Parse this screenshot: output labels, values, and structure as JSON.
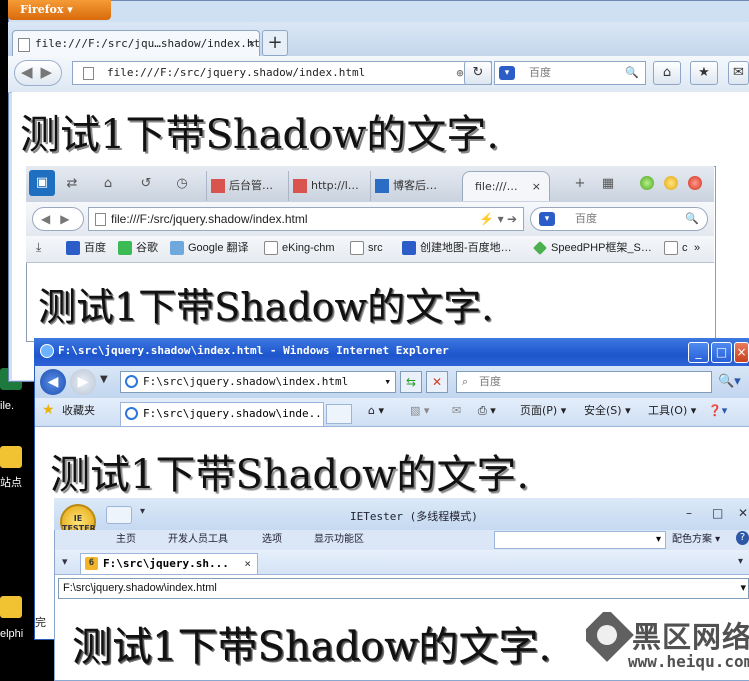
{
  "desktop": {
    "labels": [
      "ile.",
      "站点",
      "elphi"
    ]
  },
  "firefox": {
    "menu_button": "Firefox",
    "tab_title": "file:///F:/src/jqu…shadow/index.html",
    "tab_close": "×",
    "new_tab": "+",
    "url": "file:///F:/src/jquery.shadow/index.html",
    "search_placeholder": "百度",
    "heading": "测试1下带Shadow的文字."
  },
  "maxthon": {
    "tabs": [
      "后台管…",
      "http://l…",
      "博客后…",
      "file:///…"
    ],
    "active_tab_close": "×",
    "url": "file:///F:/src/jquery.shadow/index.html",
    "search_placeholder": "百度",
    "bookmarks": [
      "百度",
      "谷歌",
      "Google 翻译",
      "eKing-chm",
      "src",
      "创建地图-百度地…",
      "SpeedPHP框架_S…",
      "c",
      "»"
    ],
    "heading": "测试1下带Shadow的文字."
  },
  "ie": {
    "title": "F:\\src\\jquery.shadow\\index.html - Windows Internet Explorer",
    "url": "F:\\src\\jquery.shadow\\index.html",
    "search_placeholder": "百度",
    "favorites": "收藏夹",
    "tab_title": "F:\\src\\jquery.shadow\\inde...",
    "commands": [
      "页面(P)",
      "安全(S)",
      "工具(O)"
    ],
    "status": "完",
    "heading": "测试1下带Shadow的文字."
  },
  "ietester": {
    "title": "IETester (多线程模式)",
    "ribbon": [
      "主页",
      "开发人员工具",
      "选项",
      "显示功能区"
    ],
    "color_scheme": "配色方案",
    "tab_badge": "6",
    "tab_title": "F:\\src\\jquery.sh...",
    "tab_close": "×",
    "url": "F:\\src\\jquery.shadow\\index.html",
    "heading": "测试1下带Shadow的文字."
  },
  "watermark": {
    "text": "黑区网络",
    "url": "www.heiqu.com"
  },
  "colors": {
    "firefox_orange": "#e8801f",
    "ie_titlebar": "#1d55cd",
    "ietester_ribbon": "#dbe7f6"
  }
}
